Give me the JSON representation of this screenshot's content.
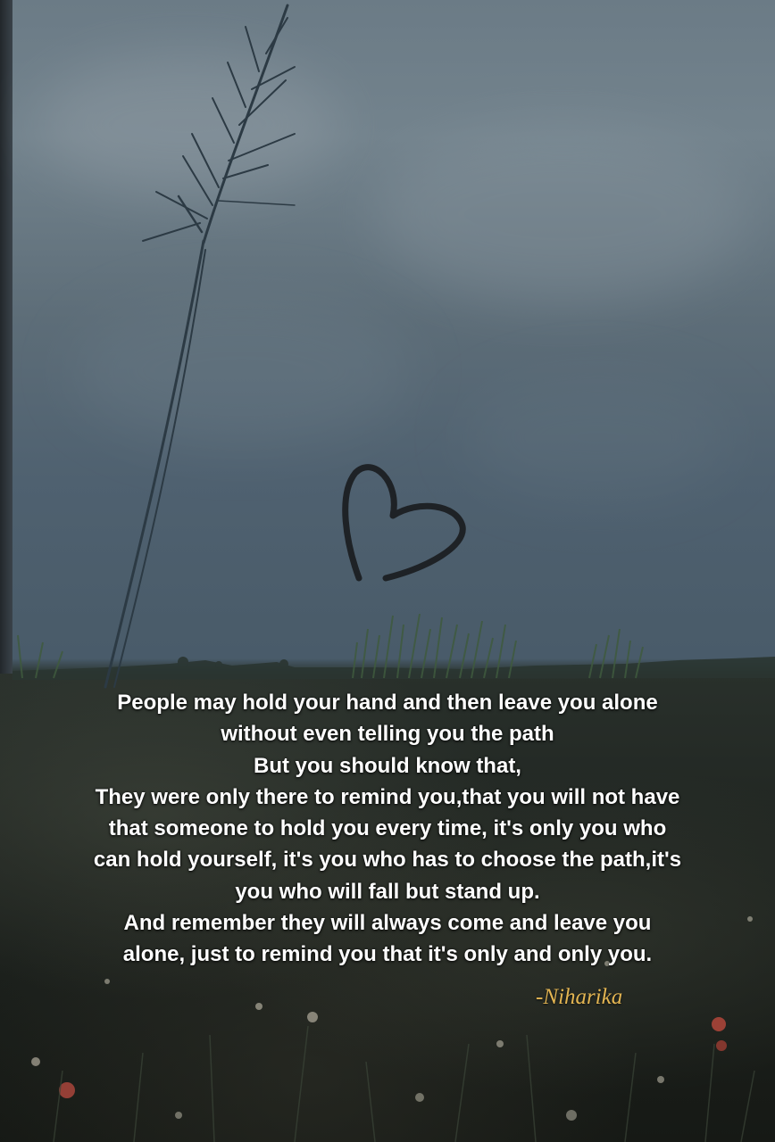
{
  "quote": {
    "lines": [
      "People may hold your hand and then leave you alone",
      "without even telling you the path",
      "But you should know that,",
      "They were only there to remind you,that you will not have",
      "that someone to hold you every time, it's only you who",
      "can hold yourself, it's you who has to choose the path,it's",
      "you who will fall but stand up.",
      "And remember they will always come and leave you",
      "alone, just to remind you that it's only and only you."
    ]
  },
  "signature": "-Niharika",
  "colors": {
    "text": "#ffffff",
    "signature": "#e3b552",
    "heart_stroke": "#1e2226"
  },
  "scene": {
    "elements": [
      "cloudy-sky",
      "tall-grass-stalk",
      "heart-drawing",
      "meadow-with-wildflowers"
    ]
  }
}
